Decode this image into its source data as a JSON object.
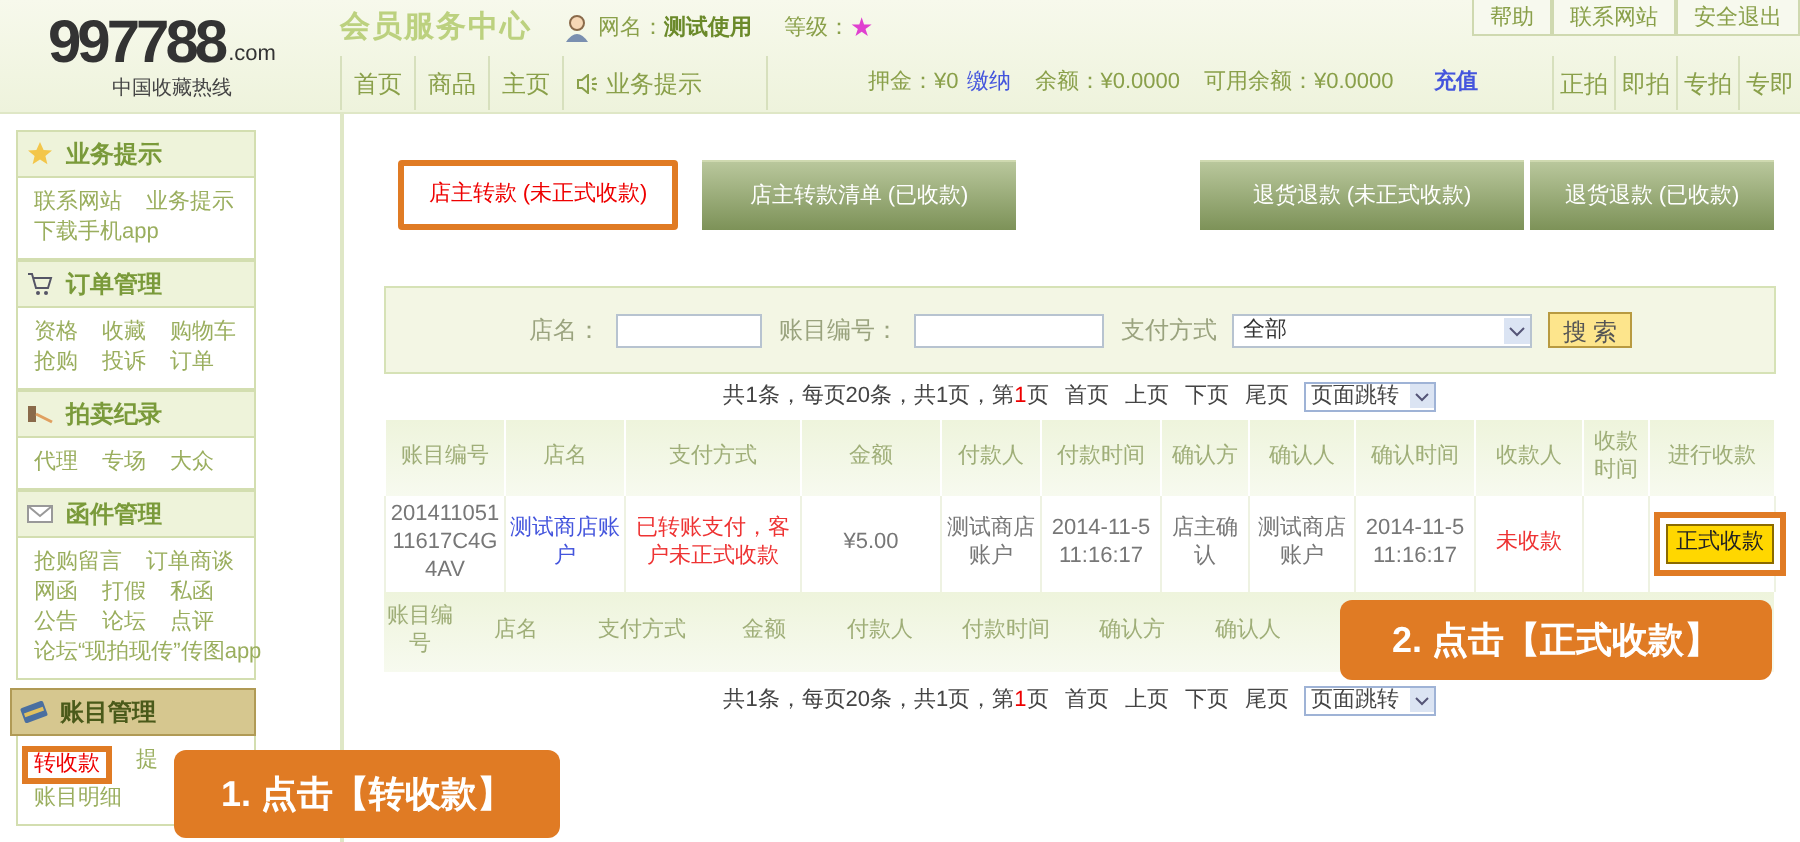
{
  "logo": {
    "mark": "997788",
    "domain": ".com",
    "tagline": "中国收藏热线"
  },
  "header": {
    "title": "会员服务中心",
    "user_label": "网名：",
    "user_name": "测试使用",
    "level_label": "等级：",
    "level_mark": "★",
    "top_links": [
      "帮助",
      "联系网站",
      "安全退出"
    ],
    "nav": [
      {
        "label": "首页",
        "kind": "plain"
      },
      {
        "label": "商品",
        "kind": "plain"
      },
      {
        "label": "主页",
        "kind": "plain"
      },
      {
        "label": "业务提示",
        "kind": "speaker"
      }
    ],
    "account": [
      {
        "label": "押金：¥0",
        "action": "缴纳"
      },
      {
        "label": "余额：¥0.0000"
      },
      {
        "label": "可用余额：¥0.0000"
      }
    ],
    "recharge": "充值",
    "quick_links": [
      "正拍",
      "即拍",
      "专拍",
      "专即"
    ]
  },
  "sidebar": [
    {
      "title": "业务提示",
      "kind": "star",
      "selected": false,
      "links": [
        {
          "label": "联系网站",
          "selected": false
        },
        {
          "label": "业务提示",
          "selected": false
        },
        {
          "label": "下载手机app",
          "selected": false
        }
      ]
    },
    {
      "title": "订单管理",
      "kind": "cart",
      "selected": false,
      "links": [
        {
          "label": "资格",
          "selected": false
        },
        {
          "label": "收藏",
          "selected": false
        },
        {
          "label": "购物车",
          "selected": false
        },
        {
          "label": "抢购",
          "selected": false
        },
        {
          "label": "投诉",
          "selected": false
        },
        {
          "label": "订单",
          "selected": false
        }
      ]
    },
    {
      "title": "拍卖纪录",
      "kind": "hammer",
      "selected": false,
      "links": [
        {
          "label": "代理",
          "selected": false
        },
        {
          "label": "专场",
          "selected": false
        },
        {
          "label": "大众",
          "selected": false
        }
      ]
    },
    {
      "title": "函件管理",
      "kind": "mail",
      "selected": false,
      "links": [
        {
          "label": "抢购留言",
          "selected": false
        },
        {
          "label": "订单商谈",
          "selected": false
        },
        {
          "label": "网函",
          "selected": false
        },
        {
          "label": "打假",
          "selected": false
        },
        {
          "label": "私函",
          "selected": false
        },
        {
          "label": "公告",
          "selected": false
        },
        {
          "label": "论坛",
          "selected": false
        },
        {
          "label": "点评",
          "selected": false
        },
        {
          "label": "论坛“现拍现传”传图app",
          "selected": false
        }
      ]
    },
    {
      "title": "账目管理",
      "kind": "card",
      "selected": true,
      "links": [
        {
          "label": "转收款",
          "selected": true
        },
        {
          "label": "提",
          "selected": false
        },
        {
          "label": "账目明细",
          "selected": false
        }
      ]
    }
  ],
  "tabs": [
    {
      "label": "店主转款 (未正式收款)",
      "selected": true
    },
    {
      "label": "店主转款清单 (已收款)",
      "selected": false
    },
    {
      "label": "退货退款 (未正式收款)",
      "selected": false
    },
    {
      "label": "退货退款 (已收款)",
      "selected": false
    }
  ],
  "search": {
    "fields": [
      {
        "label": "店名：",
        "kind": "input"
      },
      {
        "label": "账目编号：",
        "kind": "input"
      },
      {
        "label": "支付方式",
        "kind": "select",
        "value": "全部"
      }
    ],
    "button": "搜 索"
  },
  "pagination_top": {
    "before": "共1条，每页20条，共1页，第",
    "current": "1",
    "after": "页",
    "links": [
      "首页",
      "上页",
      "下页",
      "尾页"
    ],
    "jump": "页面跳转"
  },
  "table": {
    "columns": [
      "账目编号",
      "店名",
      "支付方式",
      "金额",
      "付款人",
      "付款时间",
      "确认方",
      "确认人",
      "确认时间",
      "收款人",
      "收款时间",
      "进行收款"
    ],
    "rows": [
      {
        "cells": [
          {
            "text": "20141105111617C4G4AV",
            "kind": "text"
          },
          {
            "text": "测试商店账户",
            "kind": "link"
          },
          {
            "text": "已转账支付，客户未正式收款",
            "kind": "alert"
          },
          {
            "text": "¥5.00",
            "kind": "text"
          },
          {
            "text": "测试商店账户",
            "kind": "text"
          },
          {
            "text": "2014-11-5 11:16:17",
            "kind": "text"
          },
          {
            "text": "店主确认",
            "kind": "text"
          },
          {
            "text": "测试商店账户",
            "kind": "text"
          },
          {
            "text": "2014-11-5 11:16:17",
            "kind": "text"
          },
          {
            "text": "未收款",
            "kind": "alert"
          },
          {
            "text": "",
            "kind": "empty"
          },
          {
            "text": "正式收款",
            "kind": "button",
            "highlighted": true
          }
        ]
      }
    ],
    "footer_columns": [
      "账目编号",
      "店名",
      "支付方式",
      "金额",
      "付款人",
      "付款时间",
      "确认方",
      "确认人"
    ]
  },
  "pagination_bottom": {
    "before": "共1条，每页20条，共1页，第",
    "current": "1",
    "after": "页",
    "links": [
      "首页",
      "上页",
      "下页",
      "尾页"
    ],
    "jump": "页面跳转"
  },
  "callouts": [
    {
      "text": "1. 点击【转收款】"
    },
    {
      "text": "2. 点击【正式收款】"
    }
  ]
}
